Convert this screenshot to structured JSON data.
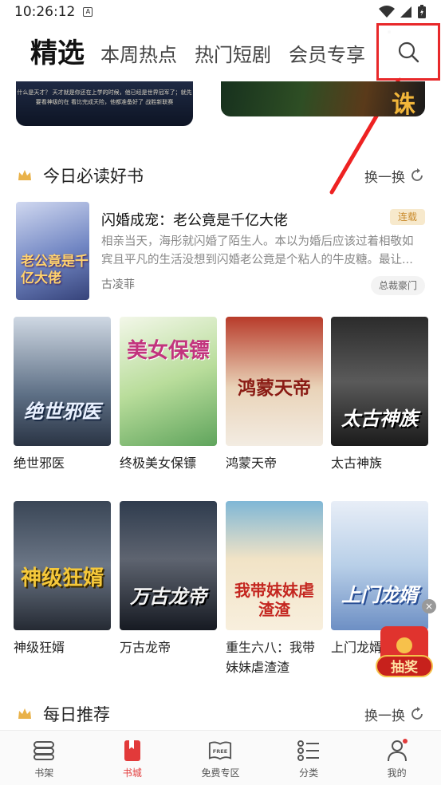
{
  "status": {
    "time": "10:26:12",
    "sim_label": "A"
  },
  "top_tabs": [
    {
      "label": "精选",
      "active": true
    },
    {
      "label": "本周热点",
      "active": false
    },
    {
      "label": "热门短剧",
      "active": false
    },
    {
      "label": "会员专享",
      "active": false
    }
  ],
  "banners": {
    "left_text": "什么是天才？ 天才就是你还在上学的时候，他已经是世界冠军了；就先要看神级的在 看比完成天险，他都准备好了 战胜新联赛",
    "right_glyph": "诛"
  },
  "section_today": {
    "title": "今日必读好书",
    "swap_label": "换一换"
  },
  "featured_book": {
    "title": "闪婚成宠：老公竟是千亿大佬",
    "status_badge": "连载",
    "description": "相亲当天，海彤就闪婚了陌生人。本以为婚后应该过着相敬如宾且平凡的生活没想到闪婚老公竟是个粘人的牛皮糖。最让...",
    "author": "古凌菲",
    "tag": "总裁豪门",
    "cover_text": "老公竟是千亿大佬"
  },
  "books_row1": [
    {
      "name": "绝世邪医",
      "cover_text": "绝世邪医"
    },
    {
      "name": "终极美女保镖",
      "cover_text": "美女保镖"
    },
    {
      "name": "鸿蒙天帝",
      "cover_text": "鸿蒙天帝"
    },
    {
      "name": "太古神族",
      "cover_text": "太古神族"
    }
  ],
  "books_row2": [
    {
      "name": "神级狂婿",
      "cover_text": "神级狂婿"
    },
    {
      "name": "万古龙帝",
      "cover_text": "万古龙帝"
    },
    {
      "name": "重生六八：我带妹妹虐渣渣",
      "cover_text": "我带妹妹虐渣渣"
    },
    {
      "name": "上门龙婿",
      "cover_text": "上门龙婿"
    }
  ],
  "floating": {
    "close": "×",
    "lottery_label": "抽奖"
  },
  "section_daily": {
    "title": "每日推荐",
    "swap_label": "换一换"
  },
  "bottom_nav": [
    {
      "label": "书架",
      "icon": "bookshelf-icon"
    },
    {
      "label": "书城",
      "icon": "bookstore-icon",
      "active": true
    },
    {
      "label": "免费专区",
      "icon": "free-book-icon"
    },
    {
      "label": "分类",
      "icon": "category-list-icon"
    },
    {
      "label": "我的",
      "icon": "profile-icon"
    }
  ],
  "colors": {
    "accent": "#e23a3a",
    "highlight_box": "#e8282a",
    "badge_bg": "#f7e9cc",
    "badge_text": "#c98a2b"
  }
}
